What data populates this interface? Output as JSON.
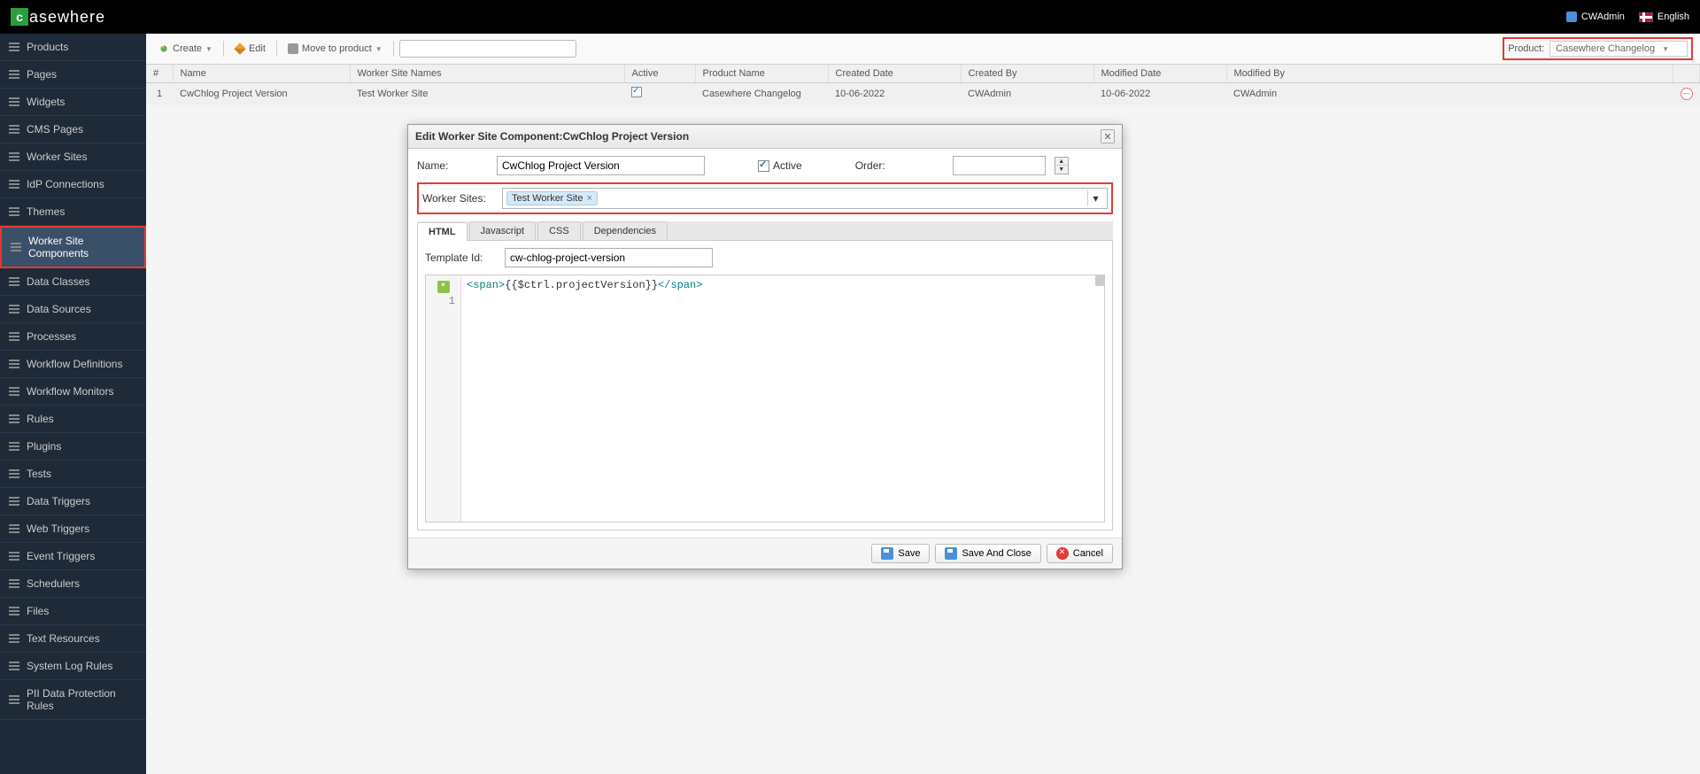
{
  "header": {
    "logo_letter": "c",
    "logo_text": "asewhere",
    "user": "CWAdmin",
    "language": "English"
  },
  "sidebar": {
    "items": [
      {
        "label": "Products"
      },
      {
        "label": "Pages"
      },
      {
        "label": "Widgets"
      },
      {
        "label": "CMS Pages"
      },
      {
        "label": "Worker Sites"
      },
      {
        "label": "IdP Connections"
      },
      {
        "label": "Themes"
      },
      {
        "label": "Worker Site Components",
        "active": true
      },
      {
        "label": "Data Classes"
      },
      {
        "label": "Data Sources"
      },
      {
        "label": "Processes"
      },
      {
        "label": "Workflow Definitions"
      },
      {
        "label": "Workflow Monitors"
      },
      {
        "label": "Rules"
      },
      {
        "label": "Plugins"
      },
      {
        "label": "Tests"
      },
      {
        "label": "Data Triggers"
      },
      {
        "label": "Web Triggers"
      },
      {
        "label": "Event Triggers"
      },
      {
        "label": "Schedulers"
      },
      {
        "label": "Files"
      },
      {
        "label": "Text Resources"
      },
      {
        "label": "System Log Rules"
      },
      {
        "label": "PII Data Protection Rules"
      }
    ]
  },
  "toolbar": {
    "create": "Create",
    "edit": "Edit",
    "move": "Move to product",
    "product_label": "Product:",
    "product_value": "Casewhere Changelog"
  },
  "table": {
    "headers": {
      "idx": "#",
      "name": "Name",
      "wsn": "Worker Site Names",
      "active": "Active",
      "product": "Product Name",
      "created_date": "Created Date",
      "created_by": "Created By",
      "modified_date": "Modified Date",
      "modified_by": "Modified By"
    },
    "rows": [
      {
        "idx": "1",
        "name": "CwChlog Project Version",
        "wsn": "Test Worker Site",
        "active": true,
        "product": "Casewhere Changelog",
        "created_date": "10-06-2022",
        "created_by": "CWAdmin",
        "modified_date": "10-06-2022",
        "modified_by": "CWAdmin"
      }
    ]
  },
  "dialog": {
    "title_prefix": "Edit Worker Site Component: ",
    "title_name": "CwChlog Project Version",
    "labels": {
      "name": "Name:",
      "active": "Active",
      "order": "Order:",
      "worker_sites": "Worker Sites:",
      "template_id": "Template Id:"
    },
    "values": {
      "name": "CwChlog Project Version",
      "order": "",
      "worker_site_tag": "Test Worker Site",
      "template_id": "cw-chlog-project-version"
    },
    "tabs": {
      "html": "HTML",
      "js": "Javascript",
      "css": "CSS",
      "deps": "Dependencies"
    },
    "code": {
      "line_no": "1",
      "open_tag": "<span>",
      "inner": "{{$ctrl.projectVersion}}",
      "close_tag": "</span>"
    },
    "buttons": {
      "save": "Save",
      "save_close": "Save And Close",
      "cancel": "Cancel"
    }
  }
}
